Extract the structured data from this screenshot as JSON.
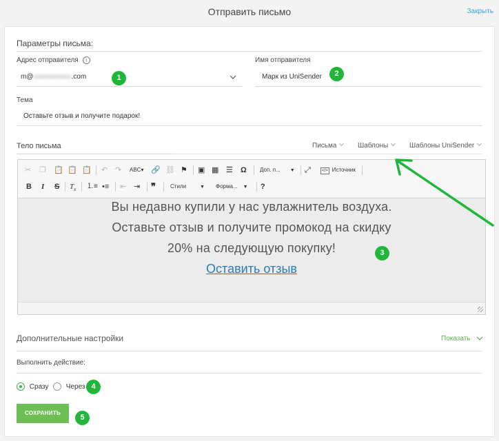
{
  "header": {
    "title": "Отправить письмо",
    "close_label": "Закрыть"
  },
  "params": {
    "title": "Параметры письма:",
    "sender_address_label": "Адрес отправителя",
    "sender_address_prefix": "m@",
    "sender_address_hidden": "xxxxxxxxxxx",
    "sender_address_suffix": ".com",
    "sender_name_label": "Имя отправителя",
    "sender_name_value": "Марк из UniSender",
    "subject_label": "Тема",
    "subject_value": "Оставьте отзыв и получите подарок!"
  },
  "body": {
    "label": "Тело письма",
    "tabs": [
      "Письма",
      "Шаблоны",
      "Шаблоны UniSender"
    ]
  },
  "toolbar": {
    "format_dropdown": "Доп. п...",
    "source_label": "Источник",
    "styles_dropdown": "Стили",
    "format2_dropdown": "Форма...",
    "help": "?"
  },
  "content": {
    "line1": "Вы недавно купили у нас увлажнитель воздуха.",
    "line2": "Оставьте отзыв и получите промокод на скидку",
    "line3": "20% на следующую покупку!",
    "link": "Оставить отзыв"
  },
  "extra": {
    "title": "Дополнительные настройки",
    "show_label": "Показать",
    "action_label": "Выполнить действие:",
    "option_now": "Сразу",
    "option_later": "Через",
    "selected": "Сразу"
  },
  "save_label": "СОХРАНИТЬ",
  "badges": [
    "1",
    "2",
    "3",
    "4",
    "5"
  ],
  "colors": {
    "accent_green": "#6cbe55",
    "badge_green": "#1fb63a",
    "link_blue": "#2a7ab8",
    "arrow_green": "#1fb63a"
  }
}
